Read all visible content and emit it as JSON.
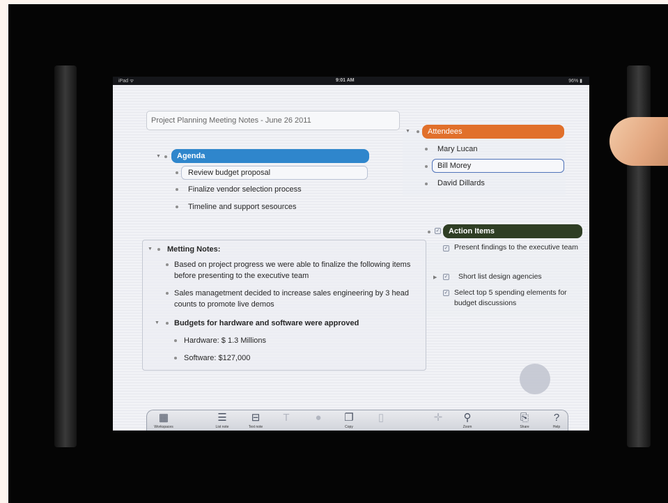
{
  "status_bar": {
    "carrier": "iPad ᯤ",
    "time": "9:01 AM",
    "battery": "96% ▮"
  },
  "document": {
    "title": "Project Planning Meeting Notes - June 26 2011"
  },
  "agenda": {
    "heading": "Agenda",
    "items": [
      "Review budget proposal",
      "Finalize vendor selection process",
      "Timeline and support sesources"
    ]
  },
  "attendees": {
    "heading": "Attendees",
    "items": [
      "Mary Lucan",
      "Bill Morey",
      "David Dillards"
    ]
  },
  "action_items": {
    "heading": "Action Items",
    "items": [
      {
        "text": "Present findings to the executive team"
      },
      {
        "text": "Short list design agencies"
      },
      {
        "text": "Select top 5 spending elements for budget discussions"
      }
    ]
  },
  "notes": {
    "heading": "Metting Notes:",
    "paragraphs": [
      "Based on project progress we were able to finalize the following items before presenting to the executive team",
      "Sales managetment decided to increase sales engineering by 3 head counts to promote live demos"
    ],
    "budgets_heading": "Budgets for hardware and software were approved",
    "budget_items": [
      "Hardware: $ 1.3 Millions",
      "Software: $127,000"
    ]
  },
  "toolbar": {
    "workspaces": "Workspaces",
    "list_note": "List note",
    "text_note": "Text note",
    "text": "",
    "color": "",
    "copy": "Copy",
    "delete": "",
    "move": "",
    "zoom": "Zoom",
    "share": "Share",
    "help": "Help"
  },
  "icons": {
    "workspaces": "grid-icon",
    "list_note": "list-icon",
    "text_note": "text-note-icon",
    "text": "font-icon",
    "color": "color-icon",
    "copy": "copy-icon",
    "delete": "trash-icon",
    "move": "move-icon",
    "zoom": "zoom-icon",
    "share": "share-icon",
    "help": "help-icon"
  },
  "colors": {
    "agenda": "#2f86cc",
    "attendees": "#e1702b",
    "action_items": "#2f3e24"
  }
}
